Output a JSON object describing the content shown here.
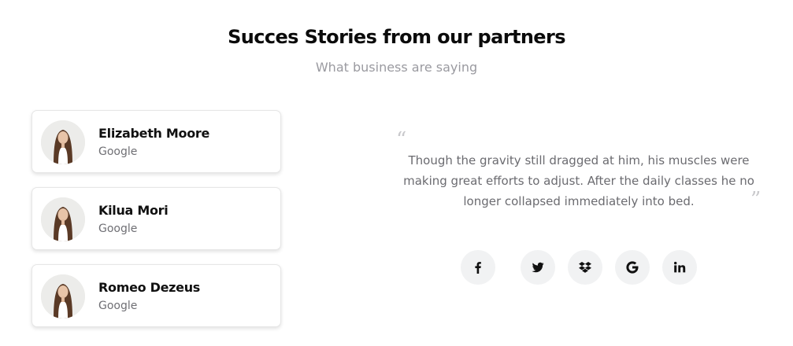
{
  "section": {
    "title": "Succes Stories from our partners",
    "subtitle": "What business are saying"
  },
  "testimonials": [
    {
      "name": "Elizabeth Moore",
      "company": "Google"
    },
    {
      "name": "Kilua Mori",
      "company": "Google"
    },
    {
      "name": "Romeo Dezeus",
      "company": "Google"
    }
  ],
  "quote": {
    "text": "Though the gravity still dragged at him, his muscles were making great efforts to adjust. After the daily classes he no longer collapsed immediately into bed.",
    "open_mark": "“",
    "close_mark": "”"
  },
  "social_icons": [
    "facebook-icon",
    "twitter-icon",
    "dropbox-icon",
    "google-icon",
    "linkedin-icon"
  ],
  "colors": {
    "title": "#0b0b0b",
    "subtitle": "#9a9aa0",
    "quote_text": "#6b6b70",
    "social_bg": "#f1f2f3"
  }
}
